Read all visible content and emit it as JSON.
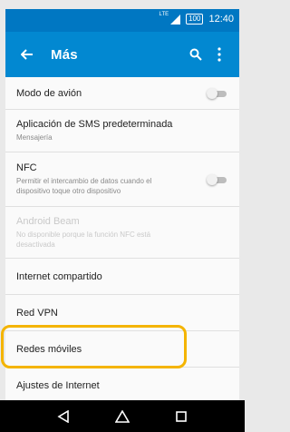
{
  "status_bar": {
    "network_label": "LTE",
    "battery_level": "100",
    "time": "12:40",
    "icons": [
      "signal-icon",
      "battery-icon"
    ]
  },
  "app_bar": {
    "title": "Más",
    "icons": [
      "back-arrow-icon",
      "search-icon",
      "more-vert-icon"
    ],
    "color": "#0288d1"
  },
  "settings": {
    "items": [
      {
        "title": "Modo de avión",
        "subtitle": "",
        "toggle": false,
        "enabled": true
      },
      {
        "title": "Aplicación de SMS predeterminada",
        "subtitle": "Mensajería",
        "enabled": true
      },
      {
        "title": "NFC",
        "subtitle": "Permitir el intercambio de datos cuando el dispositivo toque otro dispositivo",
        "toggle": false,
        "enabled": true
      },
      {
        "title": "Android Beam",
        "subtitle": "No disponible porque la función NFC está desactivada",
        "enabled": false
      },
      {
        "title": "Internet compartido",
        "subtitle": "",
        "enabled": true
      },
      {
        "title": "Red VPN",
        "subtitle": "",
        "enabled": true
      },
      {
        "title": "Redes móviles",
        "subtitle": "",
        "enabled": true,
        "highlighted": true
      },
      {
        "title": "Ajustes de Internet",
        "subtitle": "",
        "enabled": true
      }
    ]
  },
  "highlight_color": "#f4b400",
  "nav_bar": {
    "icons": [
      "back-triangle-icon",
      "home-icon",
      "recents-square-icon"
    ]
  }
}
